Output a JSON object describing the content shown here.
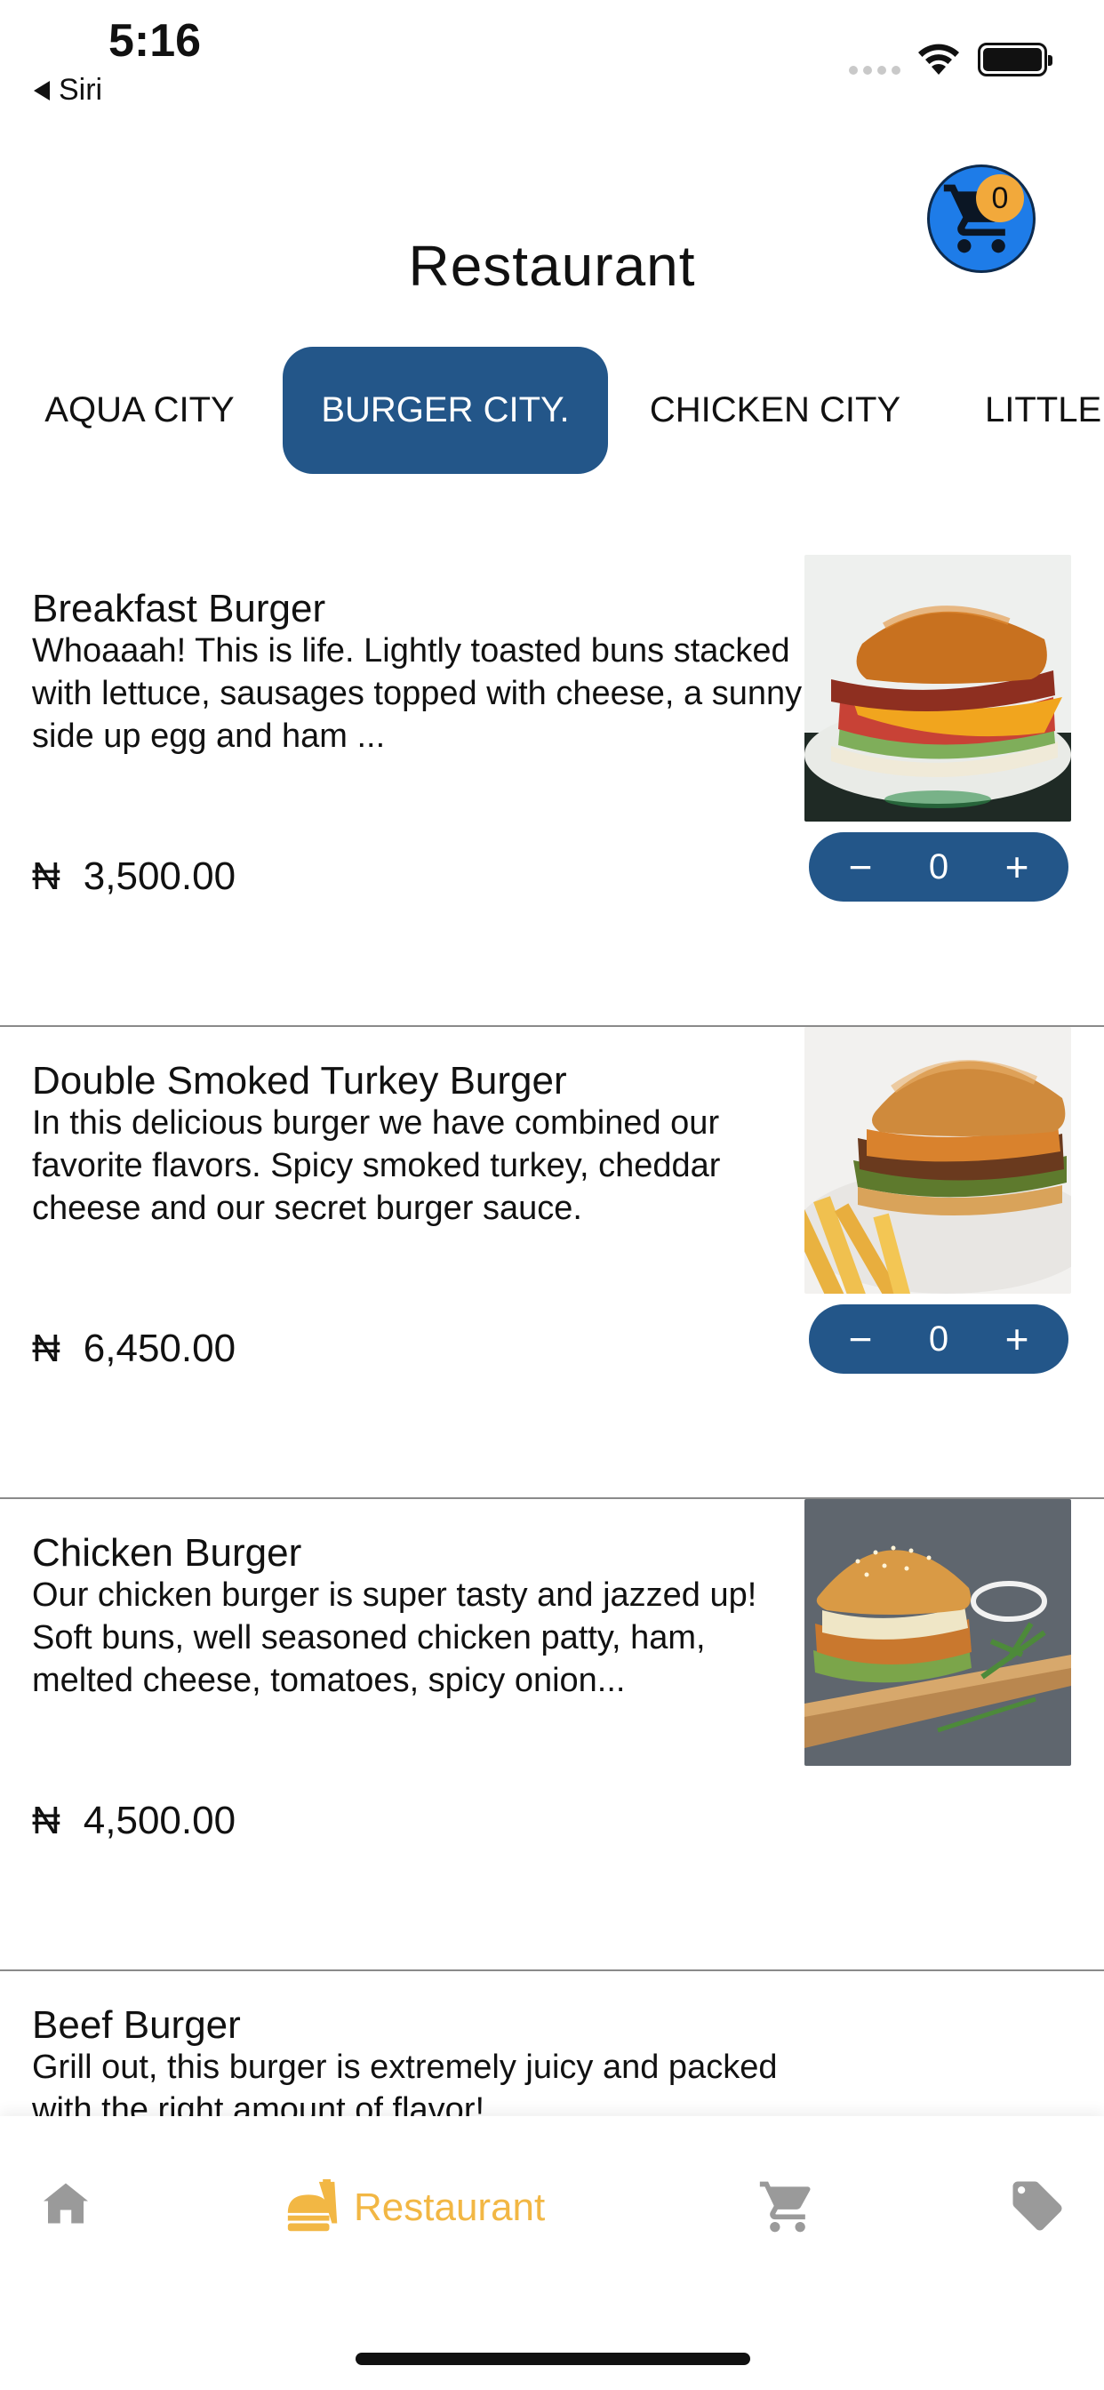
{
  "status_bar": {
    "time": "5:16",
    "back_label": "Siri"
  },
  "header": {
    "title": "Restaurant",
    "cart_count": "0",
    "cart_color": "#1e7ce8",
    "badge_color": "#f2a93b"
  },
  "tabs": [
    {
      "label": "AQUA CITY",
      "active": false
    },
    {
      "label": "BURGER CITY.",
      "active": true
    },
    {
      "label": "CHICKEN CITY",
      "active": false
    },
    {
      "label": "LITTLE C",
      "active": false
    }
  ],
  "menu": {
    "currency": "₦",
    "items": [
      {
        "name": "Breakfast Burger",
        "description": "Whoaaah! This is life. Lightly toasted buns stacked with lettuce,  sausages topped with cheese, a sunny side up egg and ham ...",
        "price": "3,500.00",
        "quantity": "0",
        "has_stepper": true
      },
      {
        "name": "Double Smoked Turkey Burger",
        "description": "In this delicious burger we have combined our favorite flavors. Spicy smoked turkey, cheddar cheese and our secret burger sauce.",
        "price": "6,450.00",
        "quantity": "0",
        "has_stepper": true
      },
      {
        "name": "Chicken Burger",
        "description": "Our chicken burger is super tasty and jazzed up! Soft buns, well seasoned chicken patty, ham, melted cheese, tomatoes, spicy onion...",
        "price": "4,500.00",
        "has_stepper": false
      },
      {
        "name": "Beef Burger",
        "description": "Grill out, this burger is extremely juicy and packed with the right amount of flavor!"
      }
    ],
    "stepper_minus": "−",
    "stepper_plus": "+"
  },
  "bottom_nav": {
    "items": [
      {
        "icon": "home-icon",
        "label": "",
        "active": false
      },
      {
        "icon": "restaurant-icon",
        "label": "Restaurant",
        "active": true
      },
      {
        "icon": "cart-icon",
        "label": "",
        "active": false
      },
      {
        "icon": "tag-icon",
        "label": "",
        "active": false
      }
    ],
    "active_color": "#f2b744",
    "inactive_color": "#9a9a9a"
  },
  "accent_color": "#235689"
}
